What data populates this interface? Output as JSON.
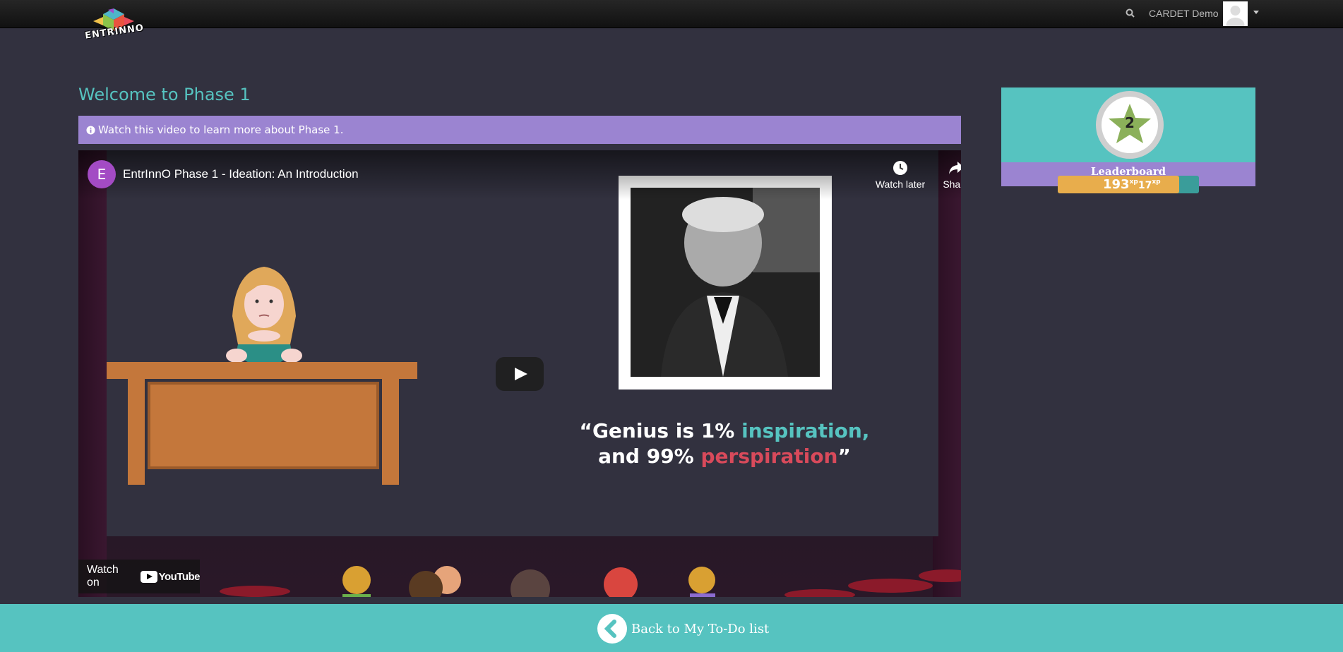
{
  "header": {
    "logo_text": "ENTRINNO",
    "user_name": "CARDET Demo"
  },
  "main": {
    "title": "Welcome to Phase 1",
    "alert_text": "Watch this video to learn more about Phase 1."
  },
  "video": {
    "channel_initial": "E",
    "title": "EntrInnO Phase 1 - Ideation: An Introduction",
    "watch_later_label": "Watch later",
    "share_label": "Share",
    "watch_on_label": "Watch on",
    "youtube_label": "YouTube",
    "quote_open": "“Genius is 1% ",
    "quote_teal": "inspiration,",
    "quote_mid": "and 99% ",
    "quote_red": "perspiration",
    "quote_close": "”"
  },
  "leaderboard": {
    "rank": "2",
    "label": "Leaderboard",
    "xp": "193",
    "xp_unit": "xp",
    "xp_next": "17",
    "xp_next_unit": "xp",
    "xp_progress": 0.86
  },
  "footer": {
    "back_label": "Back to My To-Do list"
  },
  "colors": {
    "accent_teal": "#56c3c0",
    "accent_purple": "#9b84d1",
    "xp_gold": "#e8ad4c",
    "background": "#32313f"
  }
}
